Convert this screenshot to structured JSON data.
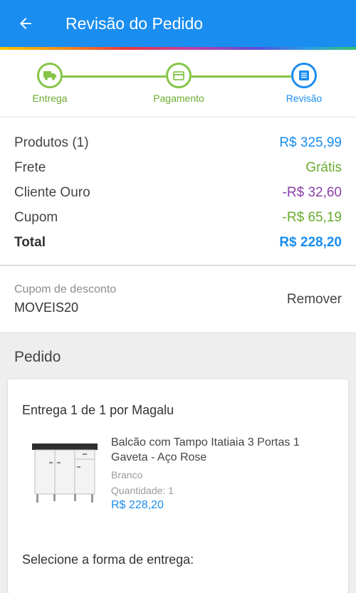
{
  "appbar": {
    "title": "Revisão do Pedido",
    "back_icon": "arrow-left-icon",
    "color": "#1a8df0"
  },
  "steps": [
    {
      "label": "Entrega",
      "icon": "truck-icon",
      "state": "done"
    },
    {
      "label": "Pagamento",
      "icon": "card-icon",
      "state": "done"
    },
    {
      "label": "Revisão",
      "icon": "document-icon",
      "state": "active"
    }
  ],
  "summary": {
    "produtos_label": "Produtos (1)",
    "produtos_value": "R$ 325,99",
    "frete_label": "Frete",
    "frete_value": "Grátis",
    "cliente_label": "Cliente Ouro",
    "cliente_value": "-R$ 32,60",
    "cupom_label": "Cupom",
    "cupom_value": "-R$ 65,19",
    "total_label": "Total",
    "total_value": "R$ 228,20"
  },
  "coupon": {
    "label": "Cupom de desconto",
    "code": "MOVEIS20",
    "remove_label": "Remover"
  },
  "pedido": {
    "title": "Pedido",
    "delivery_title": "Entrega 1 de 1 por Magalu",
    "product": {
      "name": "Balcão com Tampo Itatiaia 3 Portas 1 Gaveta - Aço Rose",
      "color": "Branco",
      "quantity": "Quantidade:  1",
      "price": "R$ 228,20"
    },
    "shipping_title": "Selecione a forma de entrega:"
  },
  "colors": {
    "primary": "#1a8df0",
    "green": "#86c548",
    "purple": "#8a3fa8"
  }
}
